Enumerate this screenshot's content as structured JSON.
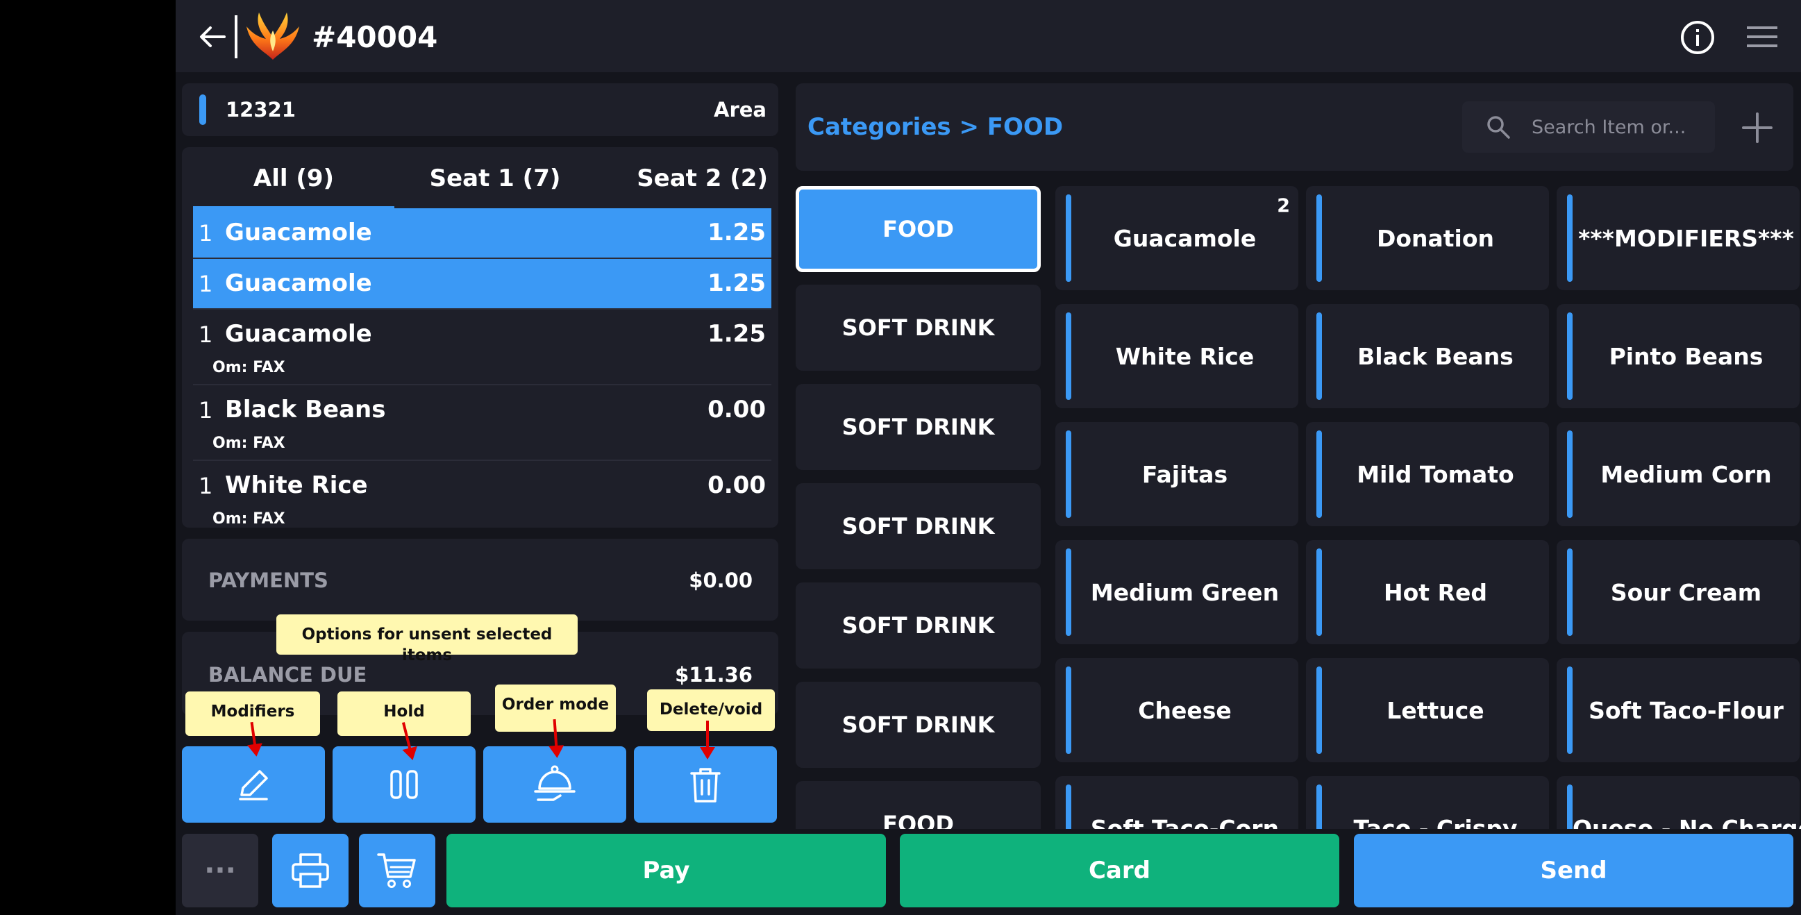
{
  "header": {
    "order_number": "#40004"
  },
  "order": {
    "table_number": "12321",
    "area_label": "Area",
    "tabs": [
      {
        "label": "All (9)",
        "active": true
      },
      {
        "label": "Seat 1 (7)",
        "active": false
      },
      {
        "label": "Seat 2 (2)",
        "active": false
      }
    ],
    "items": [
      {
        "qty": "1",
        "name": "Guacamole",
        "price": "1.25",
        "modifier": "",
        "selected": true
      },
      {
        "qty": "1",
        "name": "Guacamole",
        "price": "1.25",
        "modifier": "",
        "selected": true
      },
      {
        "qty": "1",
        "name": "Guacamole",
        "price": "1.25",
        "modifier": "Om: FAX",
        "selected": false
      },
      {
        "qty": "1",
        "name": "Black Beans",
        "price": "0.00",
        "modifier": "Om: FAX",
        "selected": false
      },
      {
        "qty": "1",
        "name": "White Rice",
        "price": "0.00",
        "modifier": "Om: FAX",
        "selected": false
      }
    ],
    "payments_label": "PAYMENTS",
    "payments_value": "$0.00",
    "balance_label": "BALANCE DUE",
    "balance_value": "$11.36"
  },
  "actions": {
    "modifiers_icon": "pencil-icon",
    "hold_icon": "pause-icon",
    "order_mode_icon": "serving-dish-icon",
    "delete_icon": "trash-icon"
  },
  "tooltips": {
    "options": "Options for unsent selected items",
    "modifiers": "Modifiers",
    "hold": "Hold",
    "order_mode": "Order mode",
    "delete": "Delete/void"
  },
  "bottom": {
    "more_label": "···",
    "pay_label": "Pay",
    "card_label": "Card",
    "send_label": "Send"
  },
  "catalog": {
    "breadcrumb": "Categories > FOOD",
    "search_placeholder": "Search Item or...",
    "categories": [
      "FOOD",
      "SOFT DRINK",
      "SOFT DRINK",
      "SOFT DRINK",
      "SOFT DRINK",
      "SOFT DRINK",
      "FOOD"
    ],
    "active_category": 0,
    "items": [
      {
        "label": "Guacamole",
        "count": "2"
      },
      {
        "label": "Donation",
        "count": ""
      },
      {
        "label": "***MODIFIERS***",
        "count": ""
      },
      {
        "label": "White Rice",
        "count": ""
      },
      {
        "label": "Black Beans",
        "count": ""
      },
      {
        "label": "Pinto Beans",
        "count": ""
      },
      {
        "label": "Fajitas",
        "count": ""
      },
      {
        "label": "Mild Tomato",
        "count": ""
      },
      {
        "label": "Medium Corn",
        "count": ""
      },
      {
        "label": "Medium Green",
        "count": ""
      },
      {
        "label": "Hot Red",
        "count": ""
      },
      {
        "label": "Sour Cream",
        "count": ""
      },
      {
        "label": "Cheese",
        "count": ""
      },
      {
        "label": "Lettuce",
        "count": ""
      },
      {
        "label": "Soft Taco-Flour",
        "count": ""
      },
      {
        "label": "Soft Taco-Corn",
        "count": ""
      },
      {
        "label": "Taco - Crispy",
        "count": ""
      },
      {
        "label": "Queso - No Charge",
        "count": ""
      }
    ]
  },
  "colors": {
    "accent_blue": "#3b99f5",
    "green": "#0fb27c",
    "panel": "#1e1f29",
    "background": "#14151c",
    "tooltip": "#fff8b0"
  }
}
